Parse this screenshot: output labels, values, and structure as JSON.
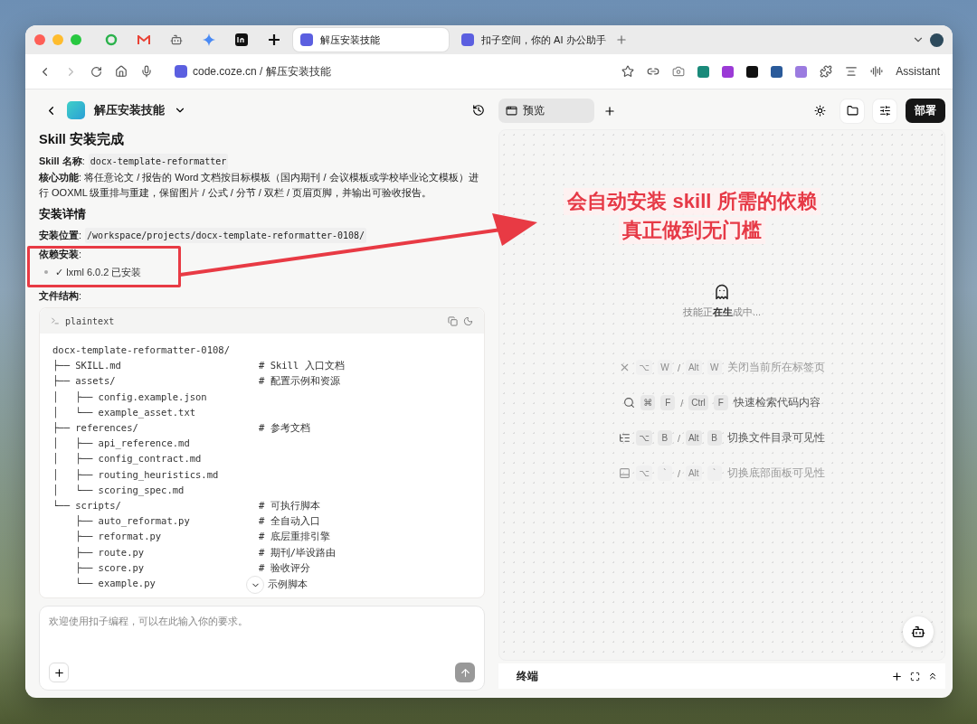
{
  "browser": {
    "tabs": [
      {
        "kind": "icon",
        "selected": false
      },
      {
        "kind": "icon",
        "selected": false
      },
      {
        "kind": "icon",
        "selected": false
      },
      {
        "kind": "icon",
        "selected": false
      },
      {
        "kind": "icon",
        "selected": false
      },
      {
        "kind": "icon",
        "selected": false
      },
      {
        "kind": "page",
        "title": "解压安装技能",
        "selected": true
      },
      {
        "kind": "page",
        "title": "扣子空间，你的 AI 办公助手",
        "selected": false
      }
    ],
    "url_host": "code.coze.cn",
    "url_path": " / 解压安装技能",
    "assistant": "Assistant"
  },
  "chat": {
    "project": "解压安装技能",
    "title": "Skill 安装完成",
    "name_label": "**Skill 名称**:",
    "name_value": "docx-template-reformatter",
    "core_text": "**核心功能**: 将任意论文 / 报告的 Word 文档按目标模板（国内期刊 / 会议模板或学校毕业论文模板）进行 OOXML 级重排与重建，保留图片 / 公式 / 分节 / 双栏 / 页眉页脚，并输出可验收报告。",
    "details_heading": "安装详情",
    "location_label": "**安装位置**:",
    "location_value": "/workspace/projects/docx-template-reformatter-0108/",
    "deps_label": "**依赖安装**:",
    "deps": [
      "✓ lxml 6.0.2 已安装"
    ],
    "structure_label": "**文件结构**:",
    "code": {
      "language": "plaintext",
      "lines": [
        {
          "path": "docx-template-reformatter-0108/"
        },
        {
          "path": "├── SKILL.md",
          "comment": "# Skill 入口文档"
        },
        {
          "path": "├── assets/",
          "comment": "# 配置示例和资源"
        },
        {
          "path": "│   ├── config.example.json"
        },
        {
          "path": "│   └── example_asset.txt"
        },
        {
          "path": "├── references/",
          "comment": "# 参考文档"
        },
        {
          "path": "│   ├── api_reference.md"
        },
        {
          "path": "│   ├── config_contract.md"
        },
        {
          "path": "│   ├── routing_heuristics.md"
        },
        {
          "path": "│   └── scoring_spec.md"
        },
        {
          "path": "└── scripts/",
          "comment": "# 可执行脚本"
        },
        {
          "path": "    ├── auto_reformat.py",
          "comment": "# 全自动入口"
        },
        {
          "path": "    ├── reformat.py",
          "comment": "# 底层重排引擎"
        },
        {
          "path": "    ├── route.py",
          "comment": "# 期刊/毕设路由"
        },
        {
          "path": "    ├── score.py",
          "comment": "# 验收评分"
        },
        {
          "path": "    └── example.py",
          "comment": "示例脚本"
        }
      ]
    },
    "input_placeholder": "欢迎使用扣子编程，可以在此输入你的要求。"
  },
  "preview": {
    "tab": "预览",
    "tab_selected": true,
    "deploy": "部署",
    "status": "技能正**在生**成中...",
    "shortcuts": [
      {
        "keys": [
          "⌥",
          "W"
        ],
        "or": "/",
        "alt_keys": [
          "Alt",
          "W"
        ],
        "text": "关闭当前所在标签页",
        "dimmed": true
      },
      {
        "keys": [
          "⌘",
          "F"
        ],
        "or": "/",
        "alt_keys": [
          "Ctrl",
          "F"
        ],
        "text": "快速检索代码内容",
        "dimmed": false
      },
      {
        "keys": [
          "⌥",
          "B"
        ],
        "or": "/",
        "alt_keys": [
          "Alt",
          "B"
        ],
        "text": "切换文件目录可见性",
        "dimmed": false
      },
      {
        "keys": [
          "⌥",
          "`"
        ],
        "or": "/",
        "alt_keys": [
          "Alt",
          "`"
        ],
        "text": "切换底部面板可见性",
        "dimmed": true
      }
    ],
    "terminal": "终端"
  },
  "annotation": {
    "lines": [
      "会自动安装 skill 所需的依赖",
      "真正做到无门槛"
    ]
  }
}
